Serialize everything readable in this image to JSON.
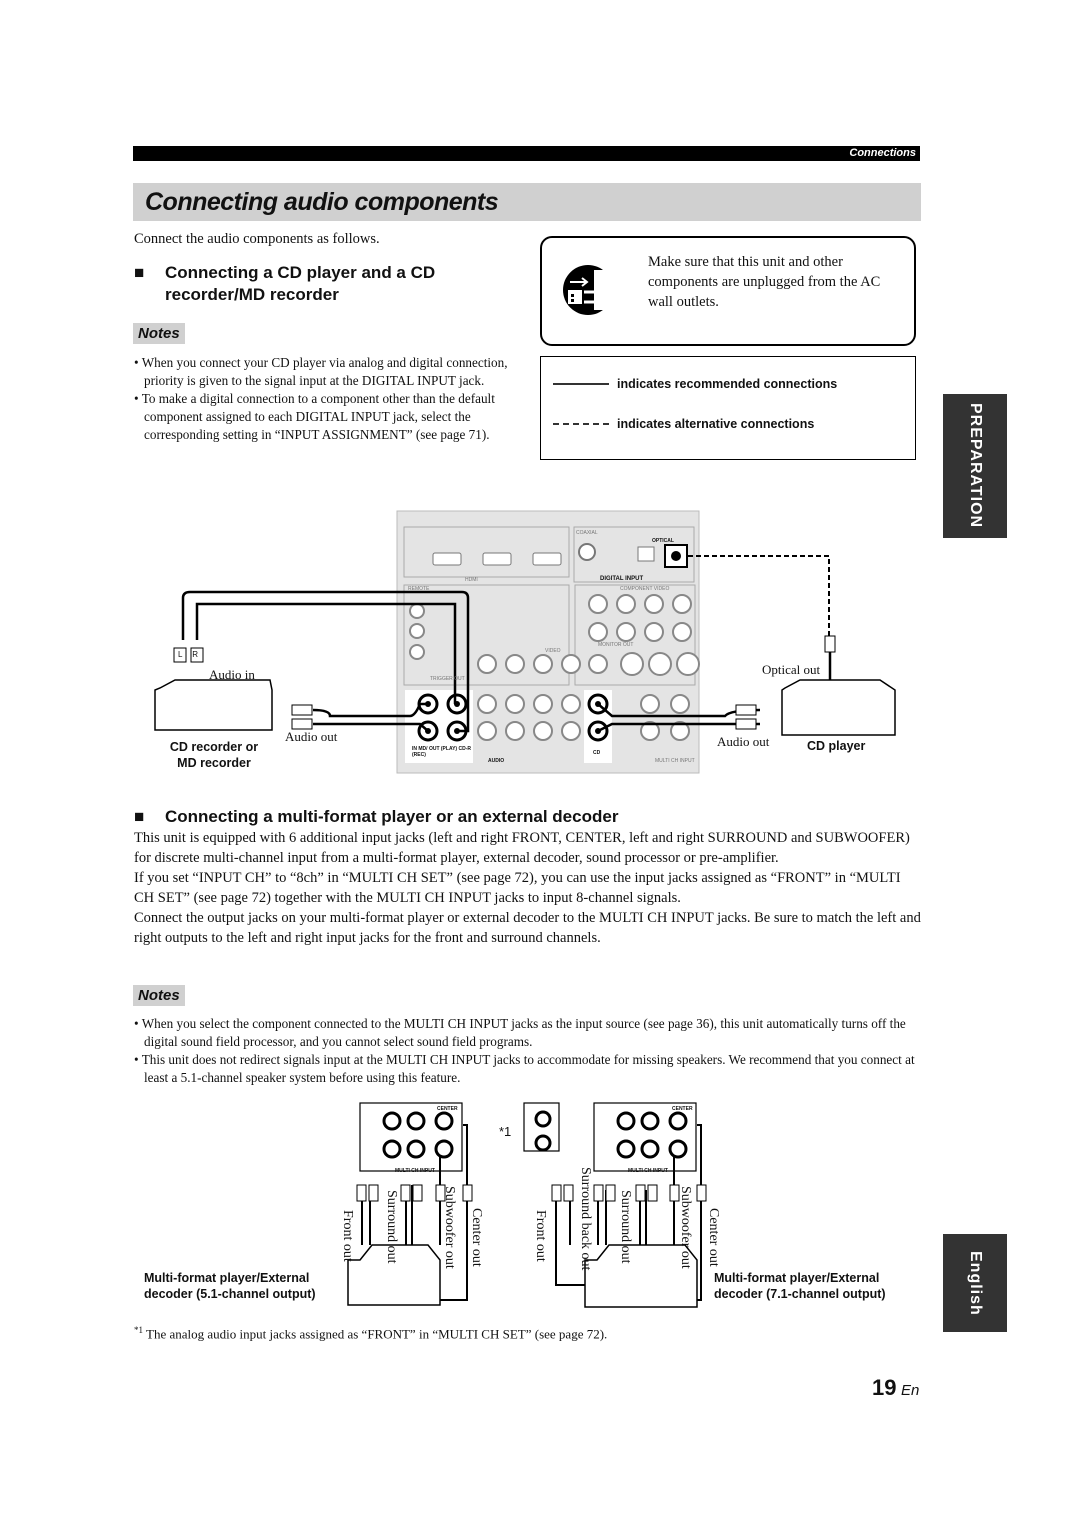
{
  "header": {
    "section": "Connections"
  },
  "title": "Connecting audio components",
  "intro": "Connect the audio components as follows.",
  "section1": {
    "heading_line1": "Connecting a CD player and a CD",
    "heading_line2": "recorder/MD recorder",
    "notes_label": "Notes",
    "notes": [
      "When you connect your CD player via analog and digital connection, priority is given to the signal input at the DIGITAL INPUT jack.",
      "To make a digital connection to a component other than the default component assigned to each DIGITAL INPUT jack, select the corresponding setting in “INPUT ASSIGNMENT” (see page 71)."
    ]
  },
  "warning": {
    "icon": "unplug-icon",
    "text": "Make sure that this unit and other components are unplugged from the AC wall outlets."
  },
  "legend": {
    "solid": "indicates recommended connections",
    "dashed": "indicates alternative connections"
  },
  "side_tabs": {
    "preparation": "PREPARATION",
    "english": "English"
  },
  "diagram1": {
    "audio_in": "Audio in",
    "audio_out_left": "Audio out",
    "cd_recorder_line1": "CD recorder or",
    "cd_recorder_line2": "MD recorder",
    "optical_out": "Optical out",
    "audio_out_right": "Audio out",
    "cd_player": "CD player",
    "panel": {
      "digital_input": "DIGITAL INPUT",
      "optical": "OPTICAL",
      "coaxial": "COAXIAL",
      "component_video": "COMPONENT VIDEO",
      "video": "VIDEO",
      "monitor_out": "MONITOR OUT",
      "audio": "AUDIO",
      "multi_ch_input": "MULTI CH INPUT",
      "remote": "REMOTE",
      "trigger_out": "TRIGGER OUT",
      "hdmi": "HDMI",
      "md_cdr": "IN MD/ OUT (PLAY) CD-R (REC)",
      "cd": "CD"
    },
    "plug_l": "L",
    "plug_r": "R"
  },
  "section2": {
    "heading": "Connecting a multi-format player or an external decoder",
    "paragraphs": [
      "This unit is equipped with 6 additional input jacks (left and right FRONT, CENTER, left and right SURROUND and SUBWOOFER) for discrete multi-channel input from a multi-format player, external decoder, sound processor or pre-amplifier.",
      "If you set “INPUT CH” to “8ch” in “MULTI CH SET” (see page 72), you can use the input jacks assigned as “FRONT” in “MULTI CH SET” (see page 72) together with the MULTI CH INPUT jacks to input 8-channel signals.",
      "Connect the output jacks on your multi-format player or external decoder to the MULTI CH INPUT jacks. Be sure to match the left and right outputs to the left and right input jacks for the front and surround channels."
    ],
    "notes_label": "Notes",
    "notes": [
      "When you select the component connected to the MULTI CH INPUT jacks as the input source (see page 36), this unit automatically turns off the digital sound field processor, and you cannot select sound field programs.",
      "This unit does not redirect signals input at the MULTI CH INPUT jacks to accommodate for missing speakers. We recommend that you connect at least a 5.1-channel speaker system before using this feature."
    ]
  },
  "diagram2": {
    "left_labels": [
      "Front out",
      "Surround out",
      "Subwoofer out",
      "Center out"
    ],
    "right_labels": [
      "Front out",
      "Surround back out",
      "Surround out",
      "Subwoofer out",
      "Center out"
    ],
    "left_device_line1": "Multi-format player/External",
    "left_device_line2": "decoder (5.1-channel output)",
    "right_device_line1": "Multi-format player/External",
    "right_device_line2": "decoder (7.1-channel output)",
    "marker": "*1",
    "center": "CENTER",
    "multi_ch_input": "MULTI CH INPUT"
  },
  "footnote": {
    "mark": "*1",
    "text": "The analog audio input jacks assigned as “FRONT” in “MULTI CH SET” (see page 72)."
  },
  "page": {
    "number": "19",
    "suffix": "En"
  }
}
